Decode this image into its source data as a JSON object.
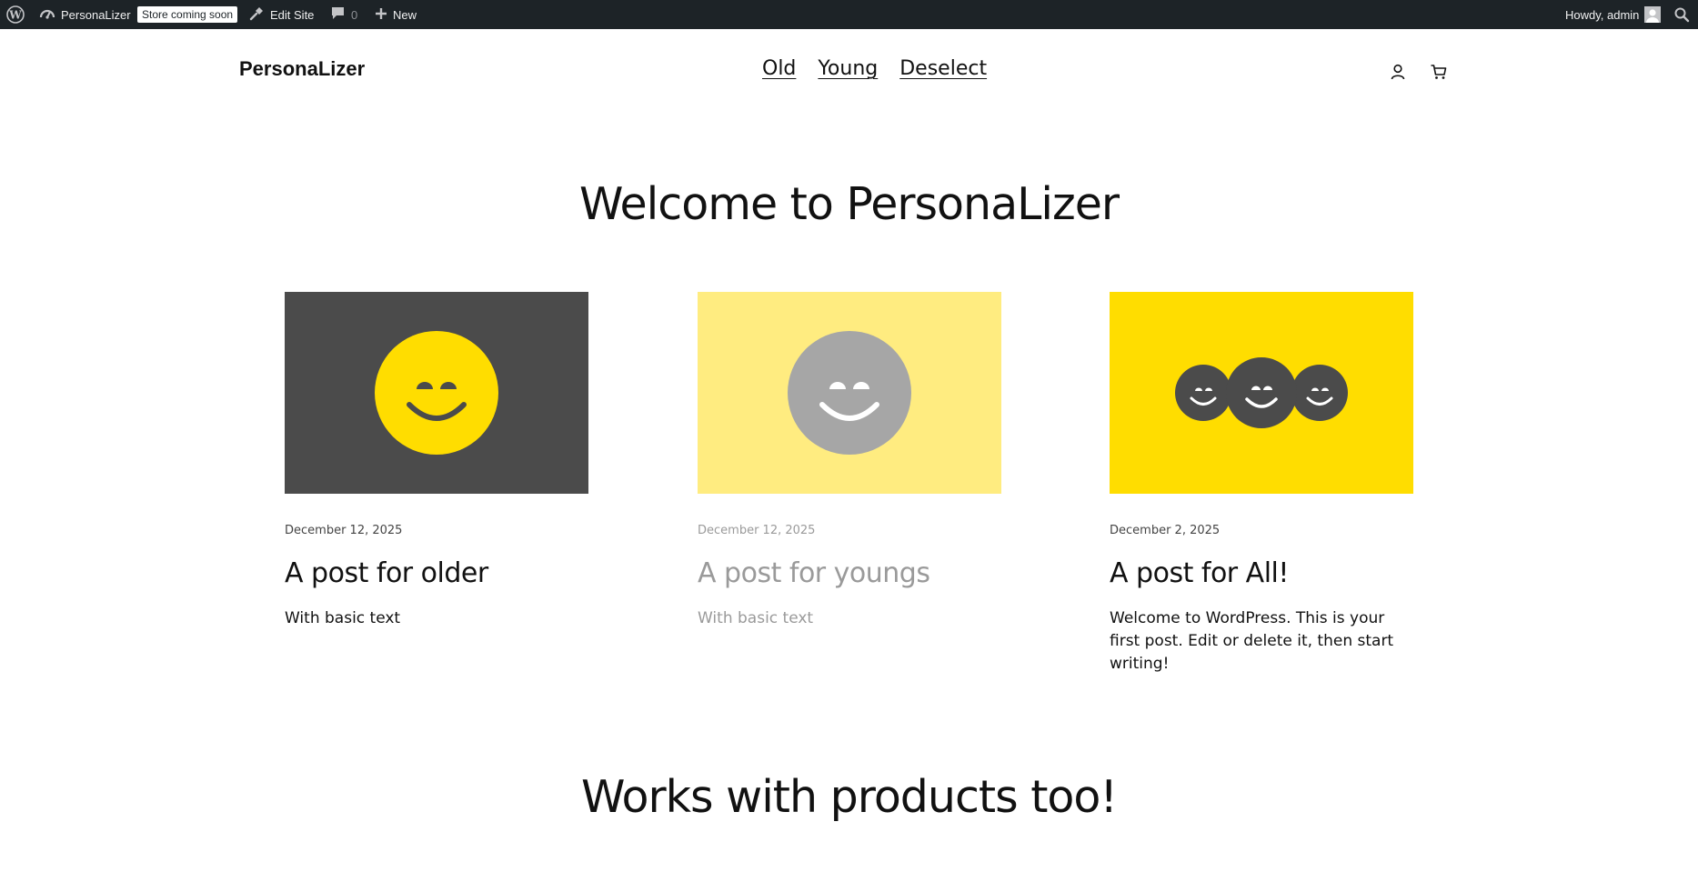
{
  "adminbar": {
    "site_name": "PersonaLizer",
    "store_badge": "Store coming soon",
    "edit_site": "Edit Site",
    "comments_count": "0",
    "new_label": "New",
    "greeting": "Howdy, admin",
    "bg_color": "#1d2327"
  },
  "header": {
    "site_title": "PersonaLizer",
    "nav": [
      "Old",
      "Young",
      "Deselect"
    ],
    "icons": [
      "account-icon",
      "cart-icon"
    ]
  },
  "main": {
    "welcome_heading": "Welcome to PersonaLizer",
    "products_heading": "Works with products too!",
    "posts": [
      {
        "date": "December 12, 2025",
        "title": "A post for older",
        "excerpt": "With basic text",
        "image_bg": "#4b4b4b",
        "smiley_color": "#ffdd00",
        "faded": false
      },
      {
        "date": "December 12, 2025",
        "title": "A post for youngs",
        "excerpt": "With basic text",
        "image_bg": "#ffec80",
        "smiley_color": "#a6a6a6",
        "faded": true
      },
      {
        "date": "December 2, 2025",
        "title": "A post for All!",
        "excerpt": "Welcome to WordPress. This is your first post. Edit or delete it, then start writing!",
        "image_bg": "#ffdd00",
        "smiley_color": "#4b4b4b",
        "faded": false
      }
    ]
  }
}
